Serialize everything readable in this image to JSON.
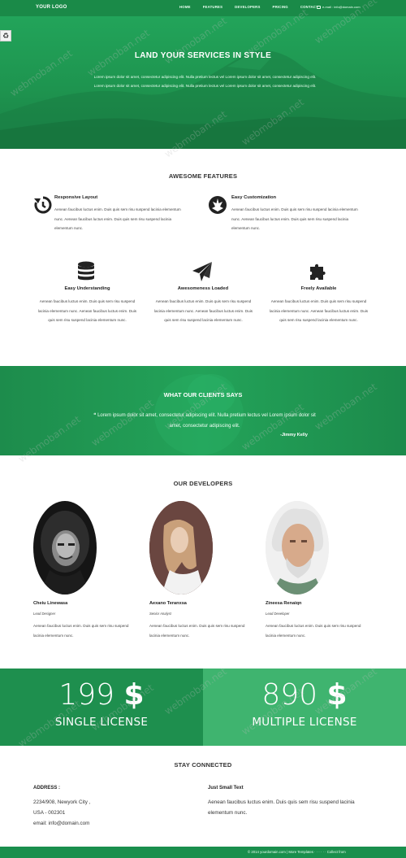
{
  "nav": {
    "logo": "YOUR LOGO",
    "items": [
      "HOME",
      "FEATURES",
      "DEVELOPERS",
      "PRICING",
      "CONTACT"
    ],
    "email": "e-mail : info@domain.com"
  },
  "hero": {
    "title": "LAND YOUR SERVICES IN STYLE",
    "text": "Lorem ipsum dolor sit amet, consectetur adipiscing elit. Nulla pretium lectus vel Lorem ipsum dolor sit amet, consectetur adipiscing elit. Lorem ipsum dolor sit amet, consectetur adipiscing elit. Nulla pretium lectus vel Lorem ipsum dolor sit amet, consectetur adipiscing elit."
  },
  "features": {
    "title": "AWESOME FEATURES",
    "items": [
      {
        "icon": "history-icon",
        "title": "Responsive Layout",
        "text": "Aenean faucibus luctus enim. Duis quis sem risu suspend lacinia elementum nunc. Aenean faucibus luctus enim. Duis quis sem risu suspend lacinia elementum nunc."
      },
      {
        "icon": "rebel-icon",
        "title": "Easy Customization",
        "text": "Aenean faucibus luctus enim. Duis quis sem risu suspend lacinia elementum nunc. Aenean faucibus luctus enim. Duis quis sem risu suspend lacinia elementum nunc."
      },
      {
        "icon": "database-icon",
        "title": "Easy Understanding",
        "text": "Aenean faucibus luctus enim. Duis quis sem risu suspend lacinia elementum nunc. Aenean faucibus luctus enim. Duis quis sem risu suspend lacinia elementum nunc."
      },
      {
        "icon": "paper-plane-icon",
        "title": "Awesomeness Loaded",
        "text": "Aenean faucibus luctus enim. Duis quis sem risu suspend lacinia elementum nunc. Aenean faucibus luctus enim. Duis quis sem risu suspend lacinia elementum nunc."
      },
      {
        "icon": "puzzle-icon",
        "title": "Freely Available",
        "text": "Aenean faucibus luctus enim. Duis quis sem risu suspend lacinia elementum nunc. Aenean faucibus luctus enim. Duis quis sem risu suspend lacinia elementum nunc."
      }
    ]
  },
  "testimonial": {
    "title": "WHAT OUR CLIENTS SAYS",
    "quote": "Lorem ipsum dolor sit amet, consectetur adipiscing elit. Nulla pretium lectus vel Lorem ipsum dolor sit amet, consectetur adipiscing elit.",
    "author": "-Jimmy Kelly"
  },
  "developers": {
    "title": "OUR DEVELOPERS",
    "items": [
      {
        "name": "Cheiu Linewasa",
        "role": "Lead Designer",
        "text": "Aenean faucibus luctus enim. Duis quis sem risu suspend lacinia elementum nunc."
      },
      {
        "name": "Aexano Teranxsa",
        "role": "Senior Analyst",
        "text": "Aenean faucibus luctus enim. Duis quis sem risu suspend lacinia elementum nunc."
      },
      {
        "name": "Zineesa Renaiqn",
        "role": "Lead Developer",
        "text": "Aenean faucibus luctus enim. Duis quis sem risu suspend lacinia elementum nunc."
      }
    ]
  },
  "pricing": {
    "single": {
      "amount": "199",
      "currency": "$",
      "label": "SINGLE LICENSE"
    },
    "multiple": {
      "amount": "890",
      "currency": "$",
      "label": "MULTIPLE LICENSE"
    }
  },
  "contact": {
    "title": "STAY CONNECTED",
    "address_label": "ADDRESS :",
    "address_line1": "2234/908, Newyork City ,",
    "address_line2": "USA - 002301",
    "email": "email: info@domain.com",
    "small_title": "Just Small Text",
    "small_text": "Aenean faucibus luctus enim. Duis quis sem risu suspend lacinia elementum nunc."
  },
  "footer": {
    "text": "© 2014 yourdomain.com | More Templates · · · · · · Collect from"
  },
  "watermark": "webmoban.net",
  "colors": {
    "accent": "#1e8f4e",
    "accent_light": "#3fb46f"
  }
}
